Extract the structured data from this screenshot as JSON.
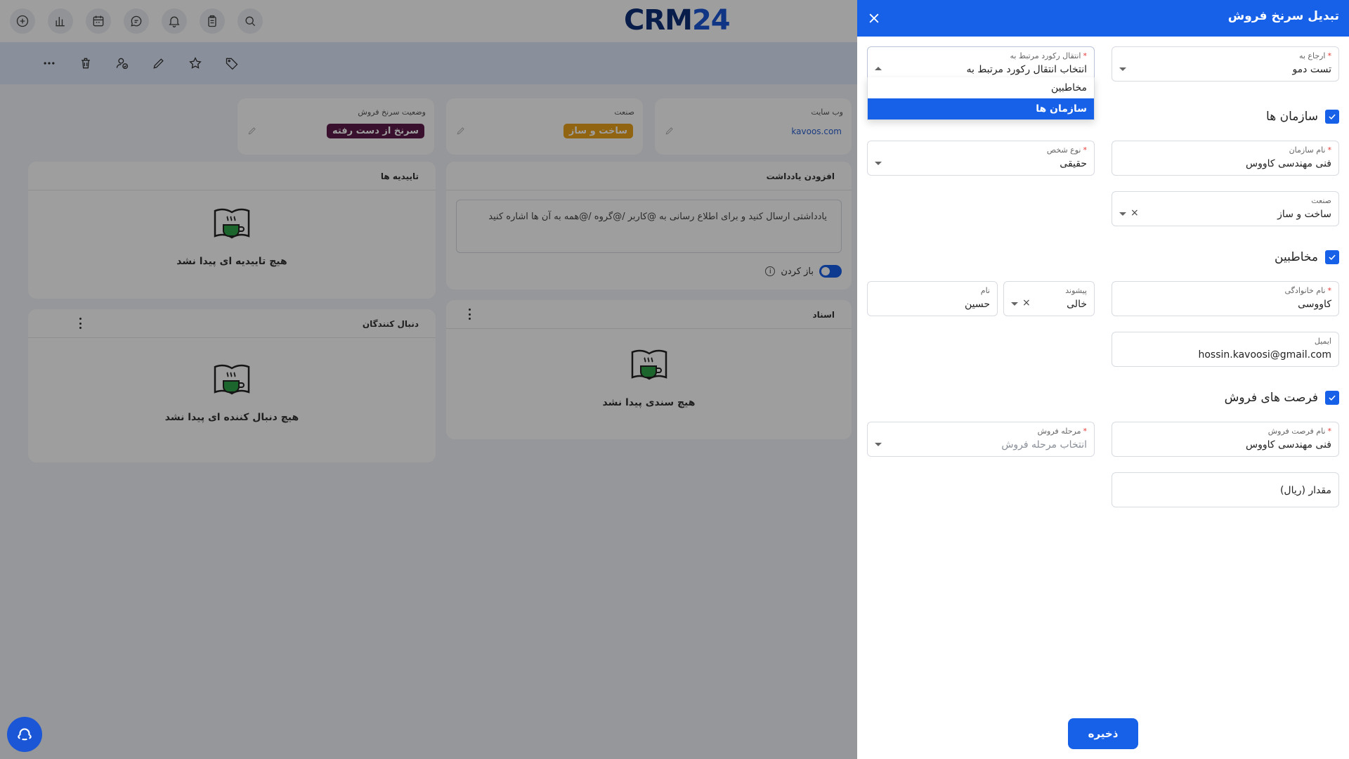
{
  "topbar": {
    "icons": [
      "add-circle-icon",
      "bar-chart-icon",
      "calendar-icon",
      "chat-icon",
      "bell-icon",
      "clipboard-icon",
      "search-icon"
    ],
    "logo_a": "CRM",
    "logo_b": "24"
  },
  "actionbar": {
    "icons": [
      "more-horizontal-icon",
      "trash-icon",
      "user-check-icon",
      "pencil-icon",
      "star-icon",
      "tag-icon"
    ]
  },
  "fields": {
    "status": {
      "label": "وضعیت سرنخ فروش",
      "value": "سرنخ از دست رفته",
      "color": "#5c1a4a"
    },
    "industry": {
      "label": "صنعت",
      "value": "ساخت و ساز",
      "color": "#e8a21a"
    },
    "website": {
      "label": "وب سایت",
      "value": "kavoos.com"
    }
  },
  "panels": {
    "approvals": {
      "title": "تاییدیه ها",
      "empty": "هیچ تاییدیه ای پیدا نشد"
    },
    "notes": {
      "title": "افزودن یادداشت",
      "placeholder": "یادداشتی ارسال کنید و برای اطلاع رسانی به @کاربر /@گروه /@همه به آن ها اشاره کنید",
      "toggle_label": "باز کردن",
      "info": "i"
    },
    "followers": {
      "title": "دنبال کنندگان",
      "empty": "هیچ دنبال کننده ای پیدا نشد"
    },
    "documents": {
      "title": "اسناد",
      "empty": "هیچ سندی پیدا نشد"
    }
  },
  "drawer": {
    "title": "تبدیل سرنخ فروش",
    "assign_to": {
      "label": "ارجاع به",
      "value": "تست دمو"
    },
    "transfer": {
      "label": "انتقال رکورد مرتبط به",
      "placeholder": "انتخاب انتقال رکورد مرتبط به",
      "options": [
        "مخاطبین",
        "سازمان ها"
      ],
      "selected": "سازمان ها"
    },
    "orgs_section": "سازمان ها",
    "org_name": {
      "label": "نام سازمان",
      "value": "فنی مهندسی کاووس"
    },
    "person_type": {
      "label": "نوع شخص",
      "value": "حقیقی"
    },
    "industry": {
      "label": "صنعت",
      "value": "ساخت و ساز",
      "clear": "×"
    },
    "contacts_section": "مخاطبین",
    "last_name": {
      "label": "نام خانوادگی",
      "value": "کاووسی"
    },
    "prefix": {
      "label": "پیشوند",
      "value": "خالی",
      "clear": "×"
    },
    "first_name": {
      "label": "نام",
      "value": "حسین"
    },
    "email": {
      "label": "ایمیل",
      "value": "hossin.kavoosi@gmail.com"
    },
    "opps_section": "فرصت های فروش",
    "opp_name": {
      "label": "نام فرصت فروش",
      "value": "فنی مهندسی کاووس"
    },
    "sales_stage": {
      "label": "مرحله فروش",
      "placeholder": "انتخاب مرحله فروش"
    },
    "amount": {
      "label": "مقدار (ریال)"
    },
    "save": "ذخیره",
    "required_mark": "*"
  }
}
